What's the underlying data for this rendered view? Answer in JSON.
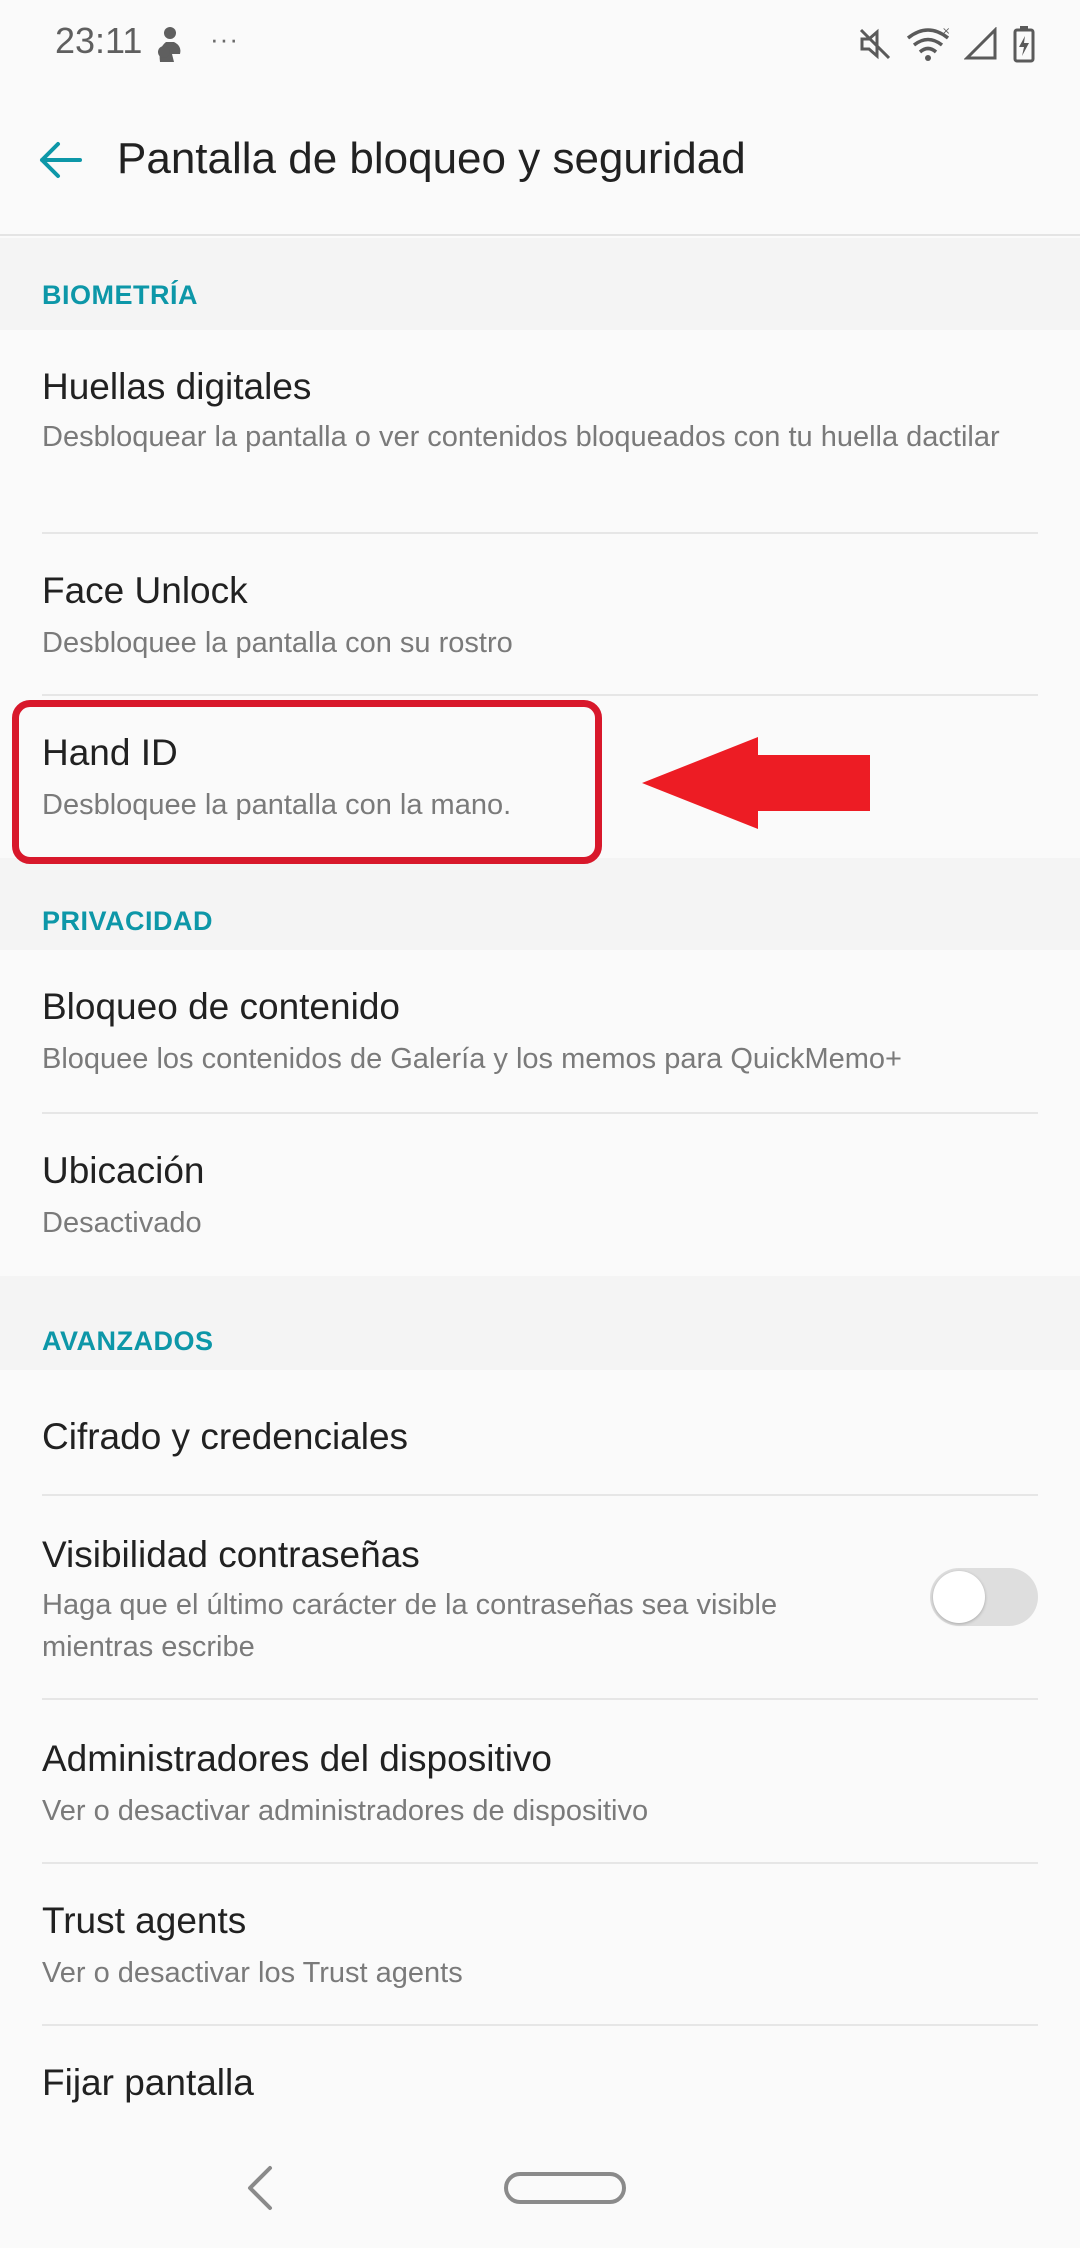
{
  "status_bar": {
    "time": "23:11",
    "dots": "···",
    "icons": [
      "notification-figure-icon",
      "mute-icon",
      "wifi-icon",
      "signal-icon",
      "battery-charging-icon"
    ]
  },
  "header": {
    "title": "Pantalla de bloqueo y seguridad",
    "back_icon": "arrow-back-icon",
    "accent_color": "#0d97a8"
  },
  "sections": {
    "biometria": {
      "title": "BIOMETRÍA",
      "items": [
        {
          "title": "Huellas digitales",
          "subtitle": "Desbloquear la pantalla o ver contenidos bloqueados con tu huella dactilar"
        },
        {
          "title": "Face Unlock",
          "subtitle": "Desbloquee la pantalla con su rostro"
        },
        {
          "title": "Hand ID",
          "subtitle": "Desbloquee la pantalla con la mano."
        }
      ]
    },
    "privacidad": {
      "title": "PRIVACIDAD",
      "items": [
        {
          "title": "Bloqueo de contenido",
          "subtitle": "Bloquee los contenidos de Galería y los memos para QuickMemo+"
        },
        {
          "title": "Ubicación",
          "subtitle": "Desactivado"
        }
      ]
    },
    "avanzados": {
      "title": "AVANZADOS",
      "items": [
        {
          "title": "Cifrado y credenciales"
        },
        {
          "title": "Visibilidad contraseñas",
          "subtitle": "Haga que el último carácter de la contraseñas sea visible mientras escribe",
          "toggle_on": false
        },
        {
          "title": "Administradores del dispositivo",
          "subtitle": "Ver o desactivar administradores de dispositivo"
        },
        {
          "title": "Trust agents",
          "subtitle": "Ver o desactivar los Trust agents"
        },
        {
          "title": "Fijar pantalla"
        }
      ]
    }
  },
  "annotation": {
    "color": "#d8182b",
    "highlighted_item": "Hand ID"
  },
  "nav_bar": {
    "icons": [
      "nav-back-icon",
      "nav-home-pill-icon"
    ]
  }
}
